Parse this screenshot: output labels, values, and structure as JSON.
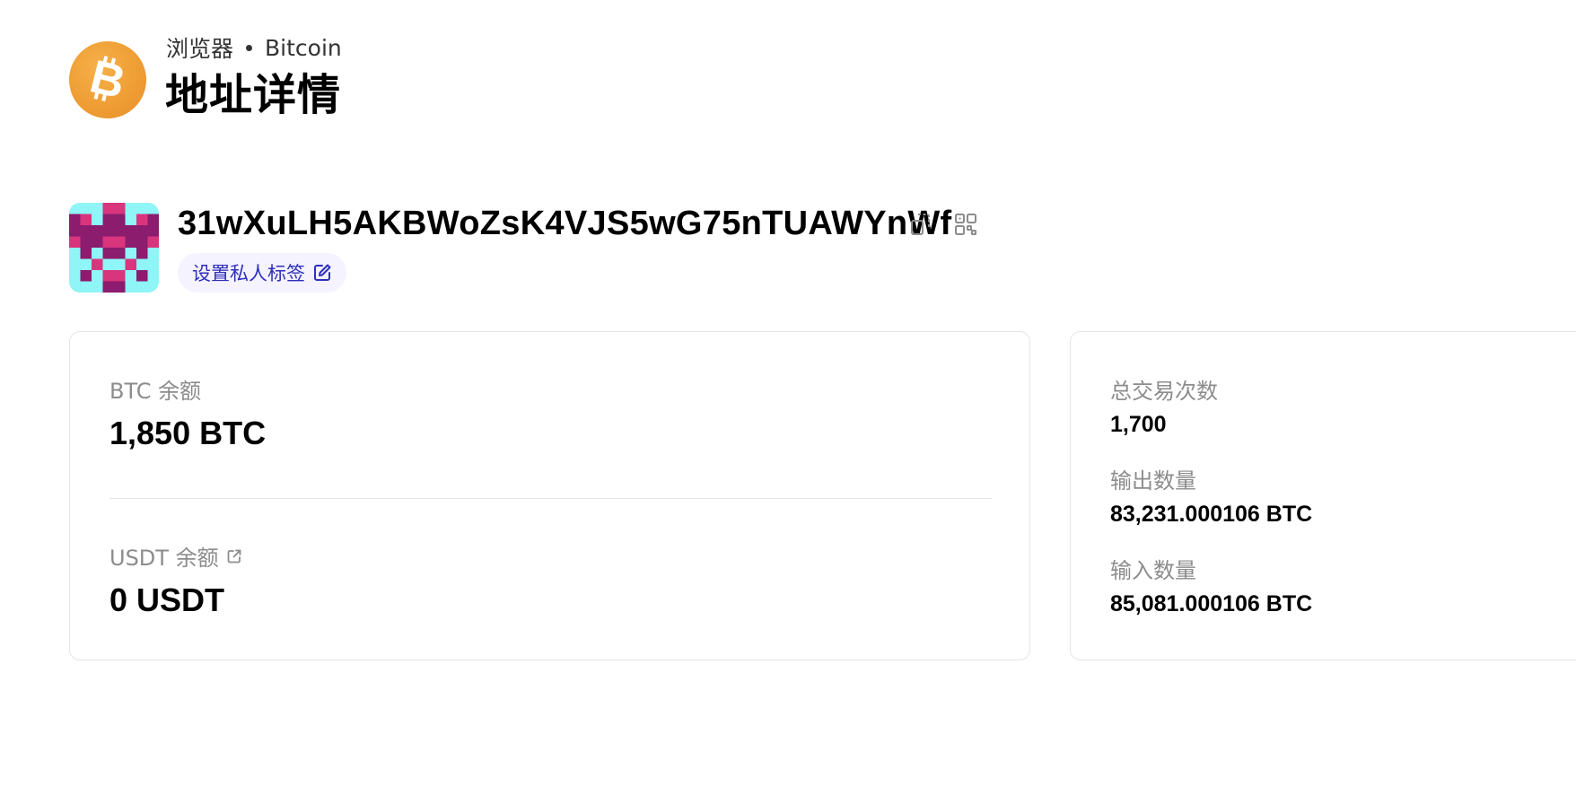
{
  "header": {
    "breadcrumb_parent": "浏览器",
    "breadcrumb_chain": "Bitcoin",
    "title": "地址详情",
    "logo_icon": "bitcoin-icon",
    "logo_color": "#F0A33C"
  },
  "address": {
    "value": "31wXuLH5AKBWoZsK4VJS5wG75nTUAWYnWf",
    "copy_icon": "copy-icon",
    "qr_icon": "qr-code-icon",
    "tag_label": "设置私人标签",
    "tag_icon": "edit-icon",
    "tag_color": "#2E2EBD",
    "avatar_colors": [
      "#8B1C6E",
      "#D8357D",
      "#8FF5F7"
    ]
  },
  "balances": {
    "btc_label": "BTC 余额",
    "btc_value": "1,850 BTC",
    "usdt_label": "USDT 余额",
    "usdt_icon": "external-link-icon",
    "usdt_value": "0 USDT"
  },
  "stats": {
    "tx_count_label": "总交易次数",
    "tx_count_value": "1,700",
    "output_label": "输出数量",
    "output_value": "83,231.000106 BTC",
    "input_label": "输入数量",
    "input_value": "85,081.000106 BTC"
  }
}
